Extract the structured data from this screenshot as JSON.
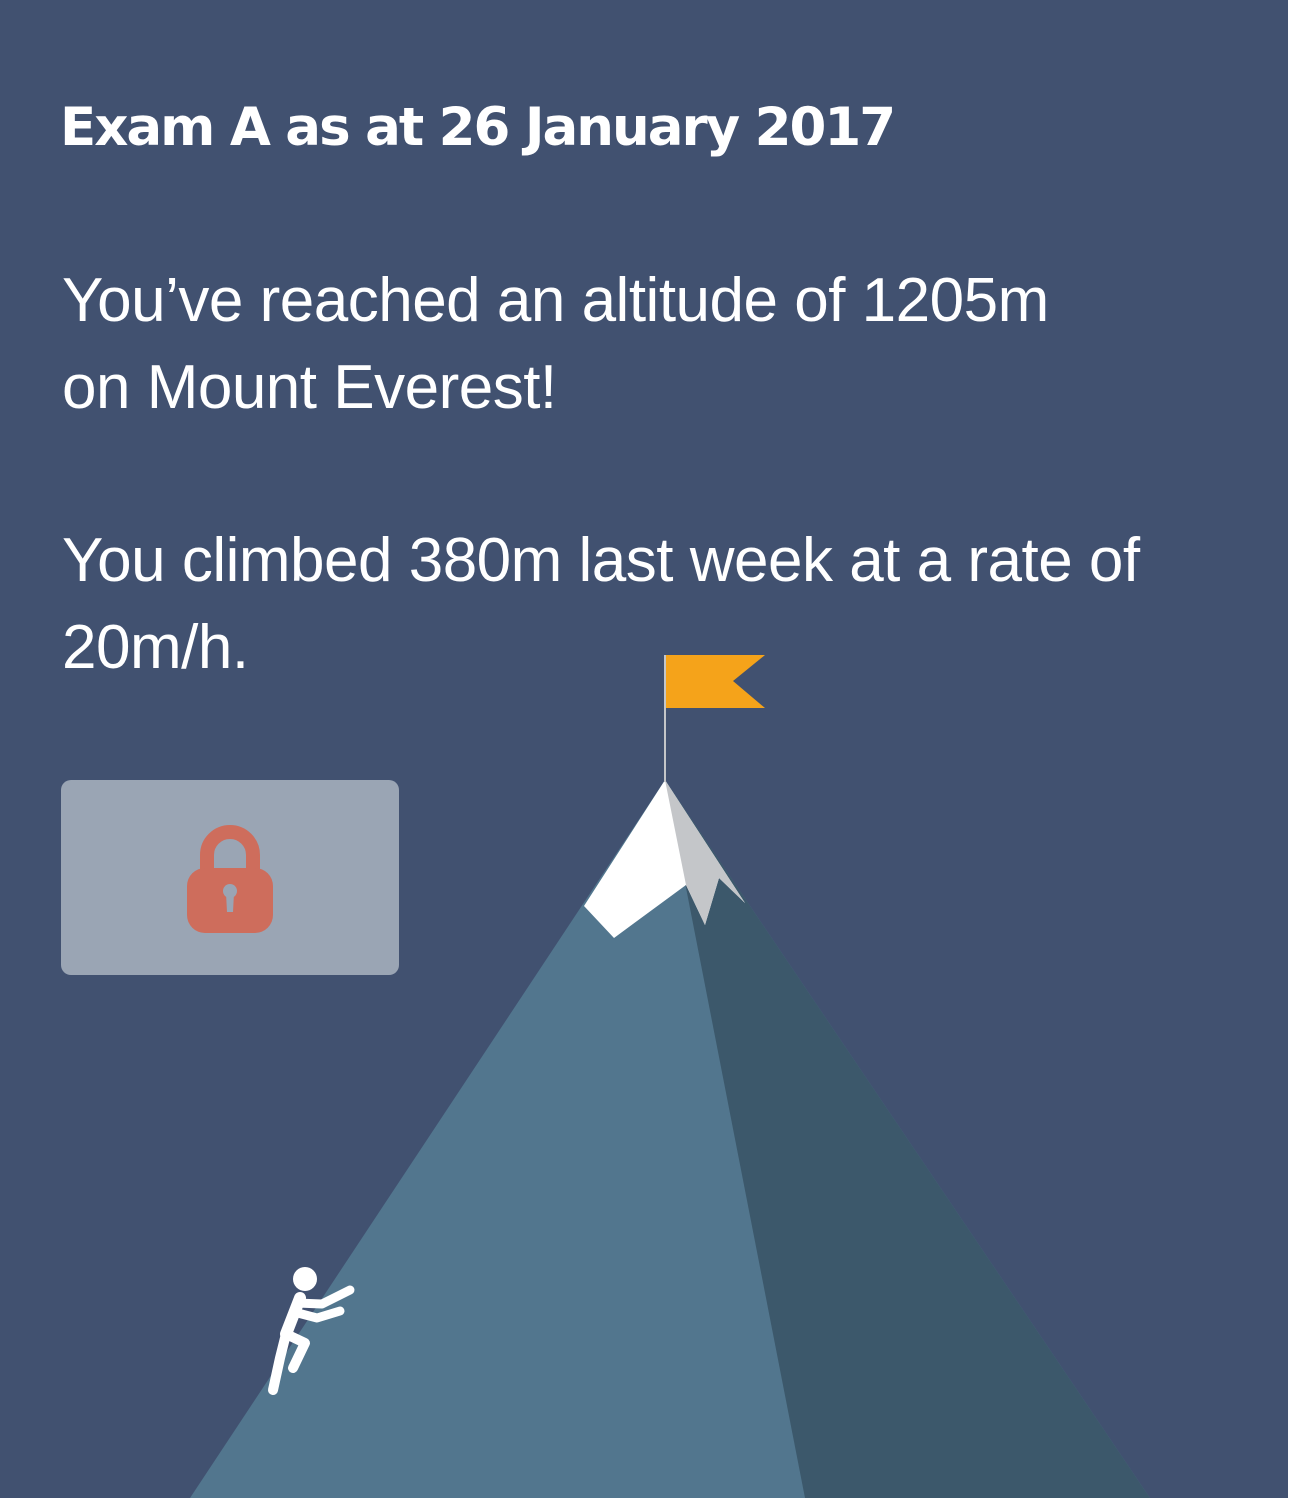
{
  "header": {
    "title": "Exam A as at 26 January 2017"
  },
  "progress": {
    "altitude_line_1": "You’ve reached an altitude of 1205m",
    "altitude_line_2": "on Mount Everest!",
    "rate_line_1": "You climbed 380m last week at a rate of",
    "rate_line_2": "20m/h."
  },
  "lock": {
    "icon": "padlock-icon",
    "state": "locked"
  },
  "illustration": {
    "mountain": "mountain-illustration",
    "flag": "flag-icon",
    "climber": "climber-icon"
  },
  "colors": {
    "background": "#415170",
    "mountain_light": "#52768E",
    "mountain_shadow": "#3C586B",
    "snow": "#FFFFFF",
    "snow_shadow": "#C4C6C9",
    "flag": "#F5A31A",
    "lock_panel": "#9AA5B4",
    "lock": "#CE6D5C"
  }
}
